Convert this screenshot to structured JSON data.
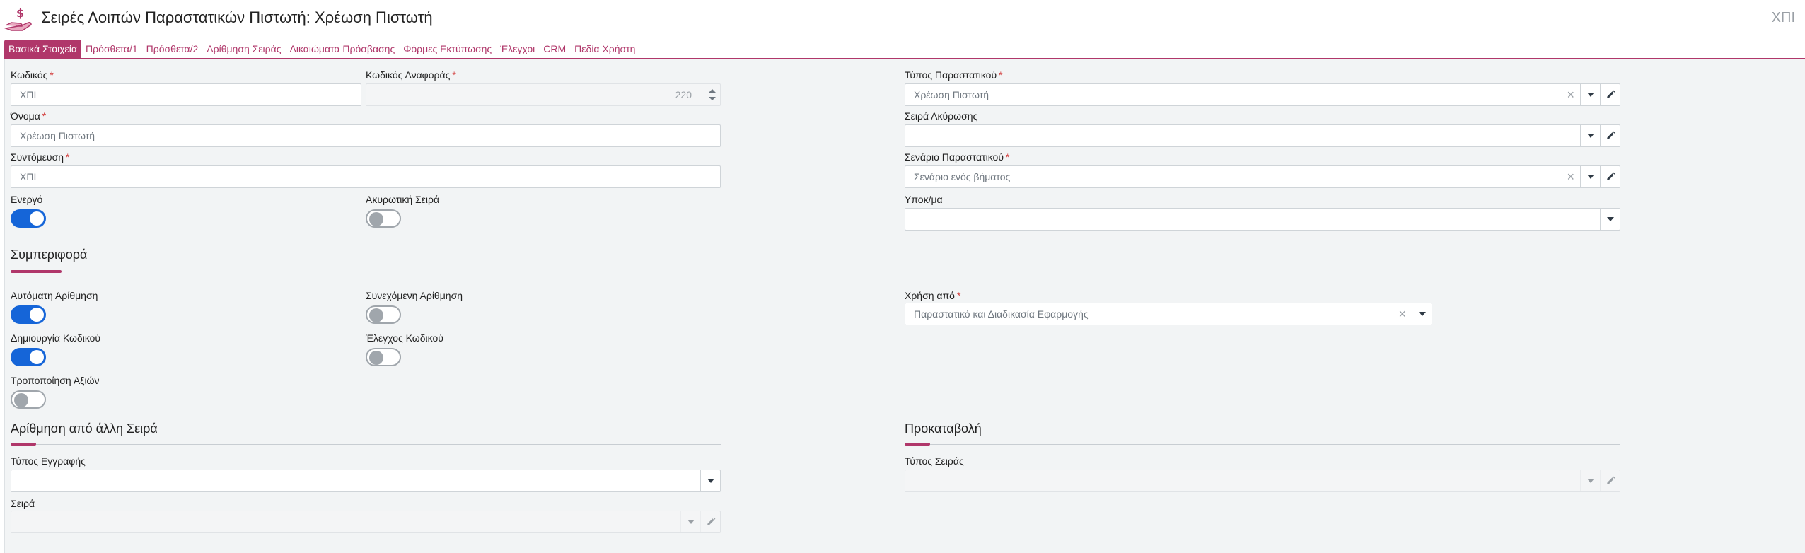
{
  "header": {
    "title": "Σειρές Λοιπών Παραστατικών Πιστωτή: Χρέωση Πιστωτή",
    "code": "ΧΠΙ",
    "icon": "hand-coin-icon"
  },
  "tabs": [
    {
      "label": "Βασικά Στοιχεία",
      "active": true
    },
    {
      "label": "Πρόσθετα/1"
    },
    {
      "label": "Πρόσθετα/2"
    },
    {
      "label": "Αρίθμηση Σειράς"
    },
    {
      "label": "Δικαιώματα Πρόσβασης"
    },
    {
      "label": "Φόρμες Εκτύπωσης"
    },
    {
      "label": "Έλεγχοι"
    },
    {
      "label": "CRM"
    },
    {
      "label": "Πεδία Χρήστη"
    }
  ],
  "fields": {
    "code": {
      "label": "Κωδικός",
      "value": "ΧΠΙ"
    },
    "ref_code": {
      "label": "Κωδικός Αναφοράς",
      "value": "220"
    },
    "name": {
      "label": "Όνομα",
      "value": "Χρέωση Πιστωτή"
    },
    "short": {
      "label": "Συντόμευση",
      "value": "ΧΠΙ"
    },
    "active": {
      "label": "Ενεργό",
      "on": true
    },
    "cancel_series": {
      "label": "Ακυρωτική Σειρά",
      "on": false
    },
    "doc_type": {
      "label": "Τύπος Παραστατικού",
      "value": "Χρέωση Πιστωτή"
    },
    "cancel_series_ref": {
      "label": "Σειρά Ακύρωσης",
      "value": ""
    },
    "scenario": {
      "label": "Σενάριο Παραστατικού",
      "value": "Σενάριο ενός βήματος"
    },
    "branch": {
      "label": "Υποκ/μα",
      "value": ""
    }
  },
  "behavior": {
    "title": "Συμπεριφορά",
    "auto_numbering": {
      "label": "Αυτόματη Αρίθμηση",
      "on": true
    },
    "continuous_numbering": {
      "label": "Συνεχόμενη Αρίθμηση",
      "on": false
    },
    "create_code": {
      "label": "Δημιουργία Κωδικού",
      "on": true
    },
    "check_code": {
      "label": "Έλεγχος Κωδικού",
      "on": false
    },
    "modify_values": {
      "label": "Τροποποίηση Αξιών",
      "on": false
    },
    "used_by": {
      "label": "Χρήση από",
      "value": "Παραστατικό και Διαδικασία Εφαρμογής"
    }
  },
  "numbering_other": {
    "title": "Αρίθμηση από άλλη Σειρά",
    "record_type": {
      "label": "Τύπος Εγγραφής",
      "value": ""
    },
    "series": {
      "label": "Σειρά",
      "value": ""
    }
  },
  "advance": {
    "title": "Προκαταβολή",
    "series_type": {
      "label": "Τύπος Σειράς",
      "value": ""
    }
  },
  "colors": {
    "accent": "#b0376a",
    "toggle_on": "#1565d8",
    "required": "#d23b3b"
  },
  "clear_glyph": "×",
  "required_mark": "*"
}
